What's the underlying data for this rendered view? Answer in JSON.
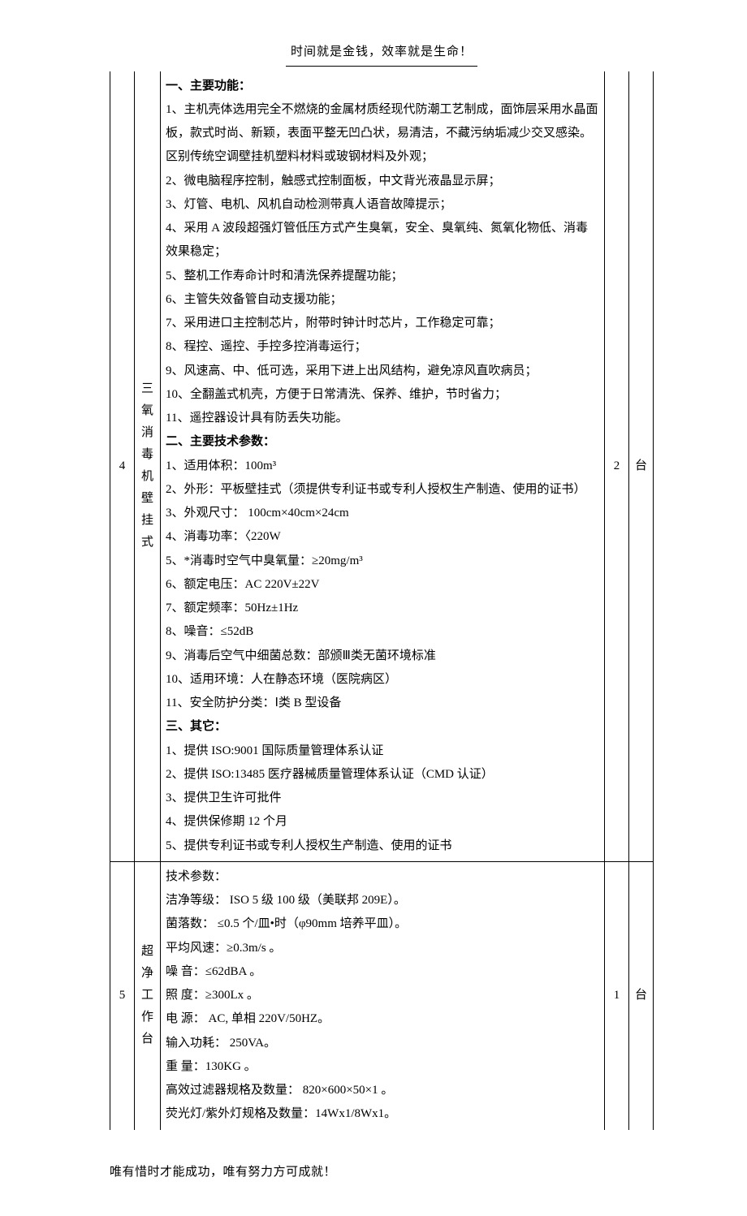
{
  "header": "时间就是金钱，效率就是生命！",
  "footer": "唯有惜时才能成功，唯有努力方可成就！",
  "rows": [
    {
      "idx": "4",
      "name": "三氧消毒机壁挂式",
      "qty": "2",
      "unit": "台",
      "desc_lines": [
        {
          "text": "一、主要功能：",
          "bold": true
        },
        {
          "text": "1、主机壳体选用完全不燃烧的金属材质经现代防潮工艺制成，面饰层采用水晶面板，款式时尚、新颖，表面平整无凹凸状，易清洁，不藏污纳垢减少交叉感染。区别传统空调壁挂机塑料材料或玻钢材料及外观；"
        },
        {
          "text": "2、微电脑程序控制，触感式控制面板，中文背光液晶显示屏；"
        },
        {
          "text": "3、灯管、电机、风机自动检测带真人语音故障提示；"
        },
        {
          "text": "4、采用 A 波段超强灯管低压方式产生臭氧，安全、臭氧纯、氮氧化物低、消毒效果稳定；"
        },
        {
          "text": "5、整机工作寿命计时和清洗保养提醒功能；"
        },
        {
          "text": "6、主管失效备管自动支援功能；"
        },
        {
          "text": "7、采用进口主控制芯片，附带时钟计时芯片，工作稳定可靠；"
        },
        {
          "text": "8、程控、遥控、手控多控消毒运行；"
        },
        {
          "text": "9、风速高、中、低可选，采用下进上出风结构，避免凉风直吹病员；"
        },
        {
          "text": "10、全翻盖式机壳，方便于日常清洗、保养、维护，节时省力；"
        },
        {
          "text": "11、遥控器设计具有防丢失功能。"
        },
        {
          "text": "二、主要技术参数：",
          "bold": true
        },
        {
          "text": "1、适用体积：100m³"
        },
        {
          "text": "2、外形：平板壁挂式（须提供专利证书或专利人授权生产制造、使用的证书）"
        },
        {
          "text": "3、外观尺寸： 100cm×40cm×24cm"
        },
        {
          "text": "4、消毒功率：〈220W"
        },
        {
          "text": "5、*消毒时空气中臭氧量：≥20mg/m³"
        },
        {
          "text": "6、额定电压：AC 220V±22V"
        },
        {
          "text": "7、额定频率：50Hz±1Hz"
        },
        {
          "text": "8、噪音：≤52dB"
        },
        {
          "text": "9、消毒后空气中细菌总数：部颁Ⅲ类无菌环境标准"
        },
        {
          "text": "10、适用环境：人在静态环境（医院病区）"
        },
        {
          "text": "11、安全防护分类：Ⅰ类 B 型设备"
        },
        {
          "text": "三、其它：",
          "bold": true
        },
        {
          "text": "1、提供 ISO:9001 国际质量管理体系认证"
        },
        {
          "text": "2、提供 ISO:13485 医疗器械质量管理体系认证（CMD 认证）"
        },
        {
          "text": "3、提供卫生许可批件"
        },
        {
          "text": "4、提供保修期 12 个月"
        },
        {
          "text": "5、提供专利证书或专利人授权生产制造、使用的证书"
        }
      ]
    },
    {
      "idx": "5",
      "name": "超净工作台",
      "qty": "1",
      "unit": "台",
      "desc_lines": [
        {
          "text": "技术参数："
        },
        {
          "text": "洁净等级：  ISO 5 级 100 级（美联邦 209E）。"
        },
        {
          "text": "菌落数：  ≤0.5 个/皿•时（φ90mm 培养平皿）。"
        },
        {
          "text": "平均风速：≥0.3m/s 。"
        },
        {
          "text": "噪 音：≤62dBA 。"
        },
        {
          "text": "照  度：≥300Lx 。"
        },
        {
          "text": "电  源：  AC, 单相 220V/50HZ。"
        },
        {
          "text": "输入功耗：  250VA。"
        },
        {
          "text": "重 量：130KG 。"
        },
        {
          "text": "高效过滤器规格及数量：  820×600×50×1 。"
        },
        {
          "text": "荧光灯/紫外灯规格及数量：14Wx1/8Wx1。"
        }
      ]
    }
  ]
}
